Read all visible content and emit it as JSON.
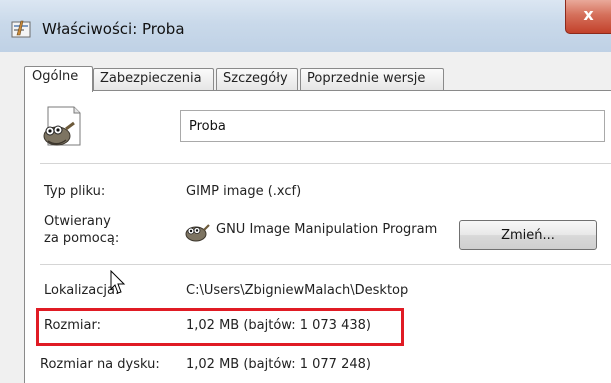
{
  "window": {
    "title": "Właściwości: Proba",
    "close_label": "x"
  },
  "tabs": [
    {
      "label": "Ogólne",
      "active": true
    },
    {
      "label": "Zabezpieczenia",
      "active": false
    },
    {
      "label": "Szczegóły",
      "active": false
    },
    {
      "label": "Poprzednie wersje",
      "active": false
    }
  ],
  "file": {
    "name": "Proba",
    "icon": "gimp-icon"
  },
  "fields": {
    "type_label": "Typ pliku:",
    "type_value": "GIMP image (.xcf)",
    "opens_label_line1": "Otwierany",
    "opens_label_line2": "za pomocą:",
    "opens_value": "GNU Image Manipulation Program",
    "change_button": "Zmień...",
    "location_label": "Lokalizacja:",
    "location_value": "C:\\Users\\ZbigniewMalach\\Desktop",
    "size_label": "Rozmiar:",
    "size_value": "1,02 MB (bajtów: 1 073 438)",
    "disk_size_label": "Rozmiar na dysku:",
    "disk_size_value": "1,02 MB (bajtów: 1 077 248)"
  },
  "colors": {
    "highlight": "#e01b24",
    "close_button": "#c2412b"
  }
}
